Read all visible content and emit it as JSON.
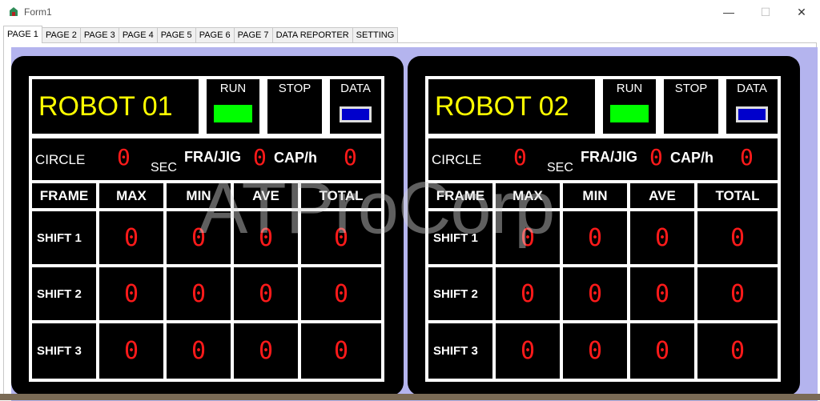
{
  "window": {
    "title": "Form1",
    "minimize": "—",
    "maximize": "☐",
    "close": "✕"
  },
  "tabs": [
    {
      "label": "PAGE 1",
      "active": true
    },
    {
      "label": "PAGE 2"
    },
    {
      "label": "PAGE 3"
    },
    {
      "label": "PAGE 4"
    },
    {
      "label": "PAGE 5"
    },
    {
      "label": "PAGE 6"
    },
    {
      "label": "PAGE 7"
    },
    {
      "label": "DATA REPORTER"
    },
    {
      "label": "SETTING"
    }
  ],
  "robots": [
    {
      "name": "ROBOT 01",
      "controls": {
        "run": "RUN",
        "stop": "STOP",
        "data": "DATA"
      },
      "stats": {
        "circle_label": "CIRCLE",
        "circle_value": "0",
        "sec_label": "SEC",
        "fra_jig_label": "FRA/JIG",
        "fra_jig_value": "0",
        "cap_label": "CAP/h",
        "cap_value": "0"
      },
      "table": {
        "headers": [
          "FRAME",
          "MAX",
          "MIN",
          "AVE",
          "TOTAL"
        ],
        "rows": [
          {
            "label": "SHIFT 1",
            "values": [
              "0",
              "0",
              "0",
              "0"
            ]
          },
          {
            "label": "SHIFT 2",
            "values": [
              "0",
              "0",
              "0",
              "0"
            ]
          },
          {
            "label": "SHIFT 3",
            "values": [
              "0",
              "0",
              "0",
              "0"
            ]
          }
        ]
      }
    },
    {
      "name": "ROBOT 02",
      "controls": {
        "run": "RUN",
        "stop": "STOP",
        "data": "DATA"
      },
      "stats": {
        "circle_label": "CIRCLE",
        "circle_value": "0",
        "sec_label": "SEC",
        "fra_jig_label": "FRA/JIG",
        "fra_jig_value": "0",
        "cap_label": "CAP/h",
        "cap_value": "0"
      },
      "table": {
        "headers": [
          "FRAME",
          "MAX",
          "MIN",
          "AVE",
          "TOTAL"
        ],
        "rows": [
          {
            "label": "SHIFT 1",
            "values": [
              "0",
              "0",
              "0",
              "0"
            ]
          },
          {
            "label": "SHIFT 2",
            "values": [
              "0",
              "0",
              "0",
              "0"
            ]
          },
          {
            "label": "SHIFT 3",
            "values": [
              "0",
              "0",
              "0",
              "0"
            ]
          }
        ]
      }
    }
  ],
  "watermark": "ATProCorp",
  "colors": {
    "frame_bg": "#b4b4ee",
    "robot_name": "#ffff00",
    "seven_segment": "#ff1a1a",
    "run_indicator": "#00ff00",
    "data_indicator": "#0000cc"
  }
}
